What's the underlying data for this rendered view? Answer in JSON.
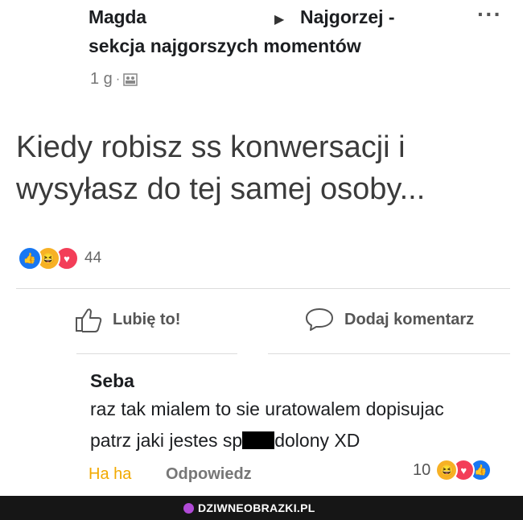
{
  "post": {
    "author": "Magda",
    "group_line1": "Najgorzej -",
    "group_line2": "sekcja najgorszych momentów",
    "time": "1 g",
    "text_line1": "Kiedy robisz ss konwersacji i",
    "text_line2": "wysyłasz do tej samej osoby...",
    "reaction_count": "44",
    "reaction_icons": [
      "like-icon",
      "haha-icon",
      "love-icon"
    ]
  },
  "actions": {
    "like_label": "Lubię to!",
    "comment_label": "Dodaj komentarz"
  },
  "comment": {
    "author": "Seba",
    "line1": "raz tak mialem to sie uratowalem dopisujac",
    "line2_before": "patrz jaki jestes sp",
    "line2_after": "dolony XD",
    "reaction_label": "Ha ha",
    "reply_label": "Odpowiedz",
    "reaction_count": "10",
    "reaction_icons": [
      "haha-icon",
      "love-icon",
      "like-icon"
    ]
  },
  "footer": {
    "brand": "DZIWNEOBRAZKI.PL"
  },
  "colors": {
    "like": "#1877f2",
    "haha": "#f7b125",
    "love": "#f33e58",
    "haha_text": "#f2a900"
  }
}
